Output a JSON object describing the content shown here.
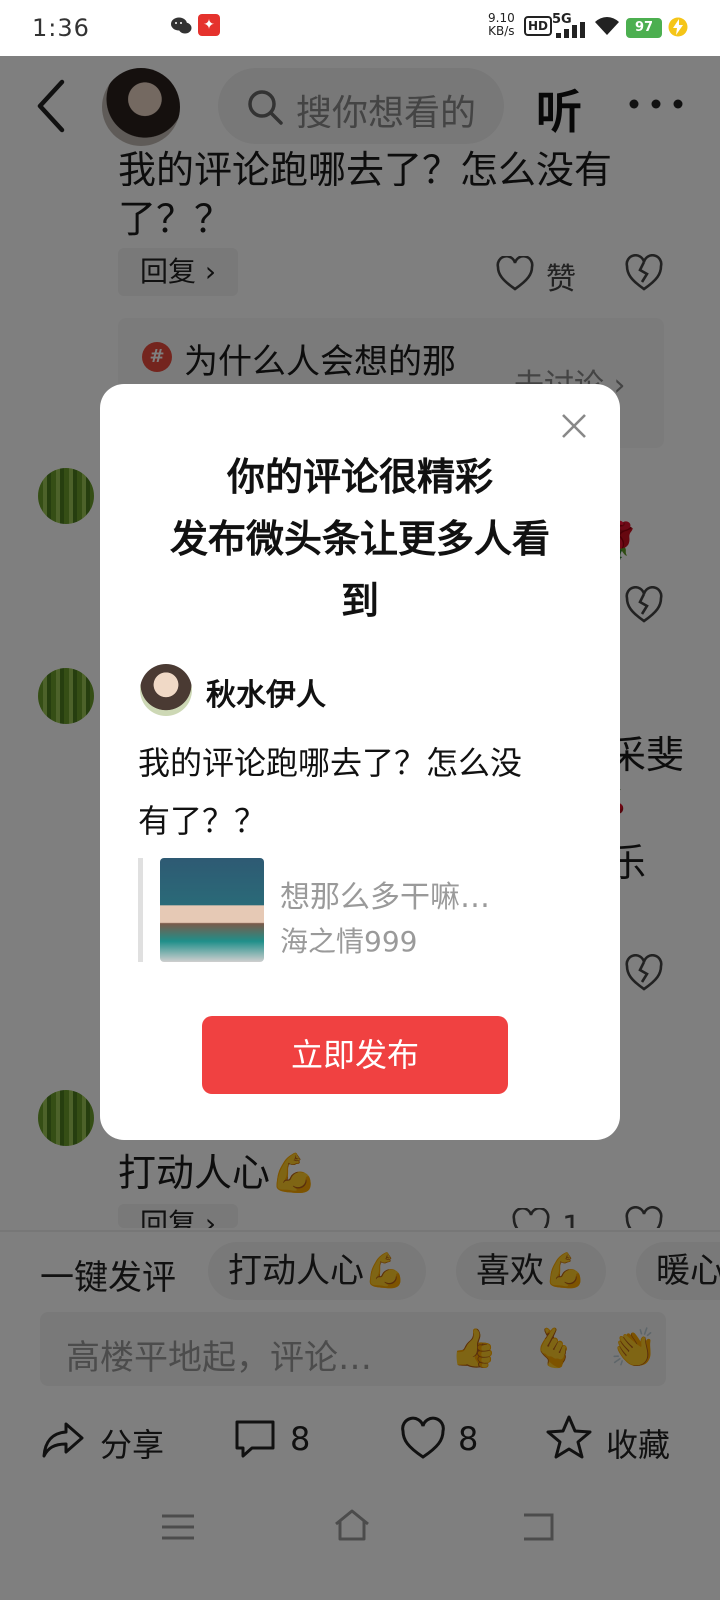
{
  "status_bar": {
    "time": "1:36",
    "network_speed_value": "9.10",
    "network_speed_unit": "KB/s",
    "hd": "HD",
    "network_type": "5G",
    "battery": "97"
  },
  "header": {
    "search_placeholder": "搜你想看的",
    "listen_label": "听"
  },
  "background": {
    "comment_top_line1": "我的评论跑哪去了？怎么没有",
    "comment_top_line2": "了？？",
    "reply_label": "回复 ›",
    "like_label": "赞",
    "topic_text": "为什么人会想的那",
    "topic_action": "去讨论 ›",
    "side_text_1": "采斐",
    "side_text_2": "乐",
    "bottom_comment": "打动人心💪",
    "reply_label_2": "回复 ›",
    "like_count_2": "1"
  },
  "quick_reply": {
    "label": "一键发评",
    "chips": [
      "打动人心💪",
      "喜欢💪",
      "暖心"
    ]
  },
  "input": {
    "placeholder": "高楼平地起，评论…"
  },
  "bottom_bar": {
    "share_label": "分享",
    "comment_count": "8",
    "like_count": "8",
    "favorite_label": "收藏"
  },
  "dialog": {
    "title_line1": "你的评论很精彩",
    "title_line2": "发布微头条让更多人看",
    "title_line3": "到",
    "username": "秋水伊人",
    "comment_line1": "我的评论跑哪去了？怎么没",
    "comment_line2": "有了？？",
    "quote_text": "想那么多干嘛…",
    "quote_author": "海之情999",
    "publish_label": "立即发布"
  },
  "colors": {
    "accent_red": "#f04141",
    "battery_green": "#4caf50"
  }
}
